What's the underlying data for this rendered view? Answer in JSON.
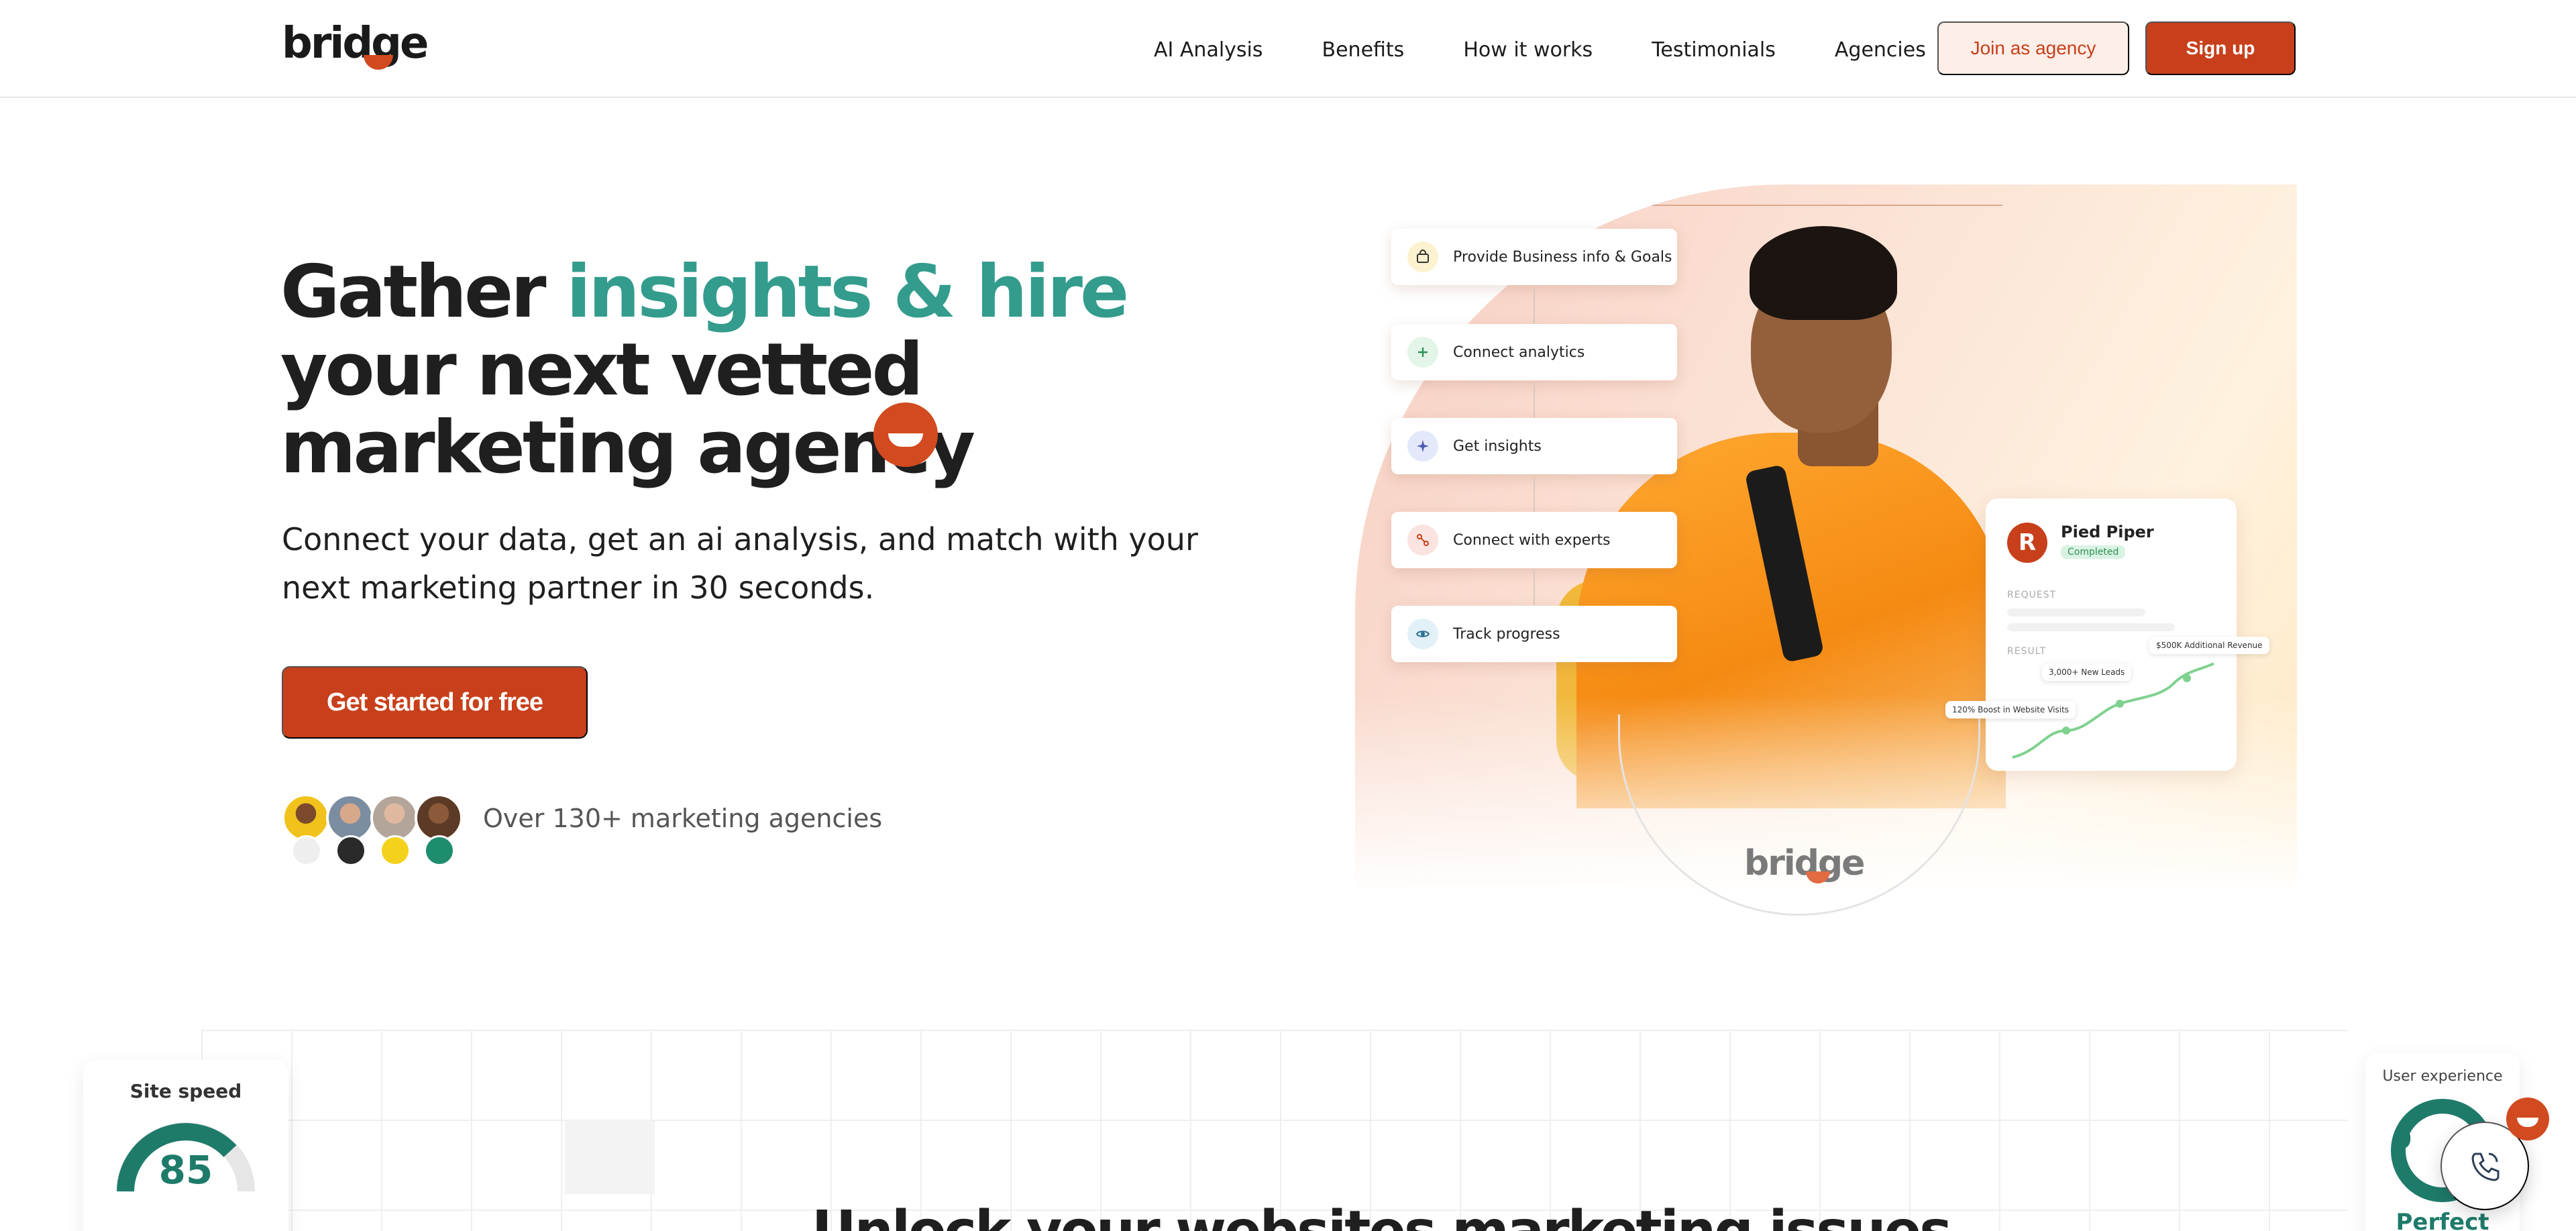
{
  "brand": {
    "logo_text": "bridge",
    "accent_color": "#c7401b",
    "teal_color": "#339c8d"
  },
  "nav": {
    "links": [
      "AI Analysis",
      "Benefits",
      "How it works",
      "Testimonials",
      "Agencies"
    ],
    "join_label": "Join as agency",
    "signup_label": "Sign up"
  },
  "hero": {
    "title_part1": "Gather ",
    "title_accent": "insights & hire",
    "title_line2": "your next vetted",
    "title_line3": "marketing agency",
    "subtitle": "Connect your data, get an ai analysis, and match with your next marketing partner in 30 seconds.",
    "cta_label": "Get started for free",
    "agencies_text": "Over 130+ marketing agencies"
  },
  "steps": [
    {
      "label": "Provide Business info & Goals",
      "icon": "bag-icon"
    },
    {
      "label": "Connect analytics",
      "icon": "plus-icon"
    },
    {
      "label": "Get insights",
      "icon": "sparkle-icon"
    },
    {
      "label": "Connect with experts",
      "icon": "connect-icon"
    },
    {
      "label": "Track progress",
      "icon": "eye-icon"
    }
  ],
  "result_card": {
    "logo_letter": "R",
    "company": "Pied Piper",
    "status": "Completed",
    "request_label": "REQUEST",
    "result_label": "RESULT",
    "tags": [
      "120% Boost in Website Visits",
      "3,000+ New Leads",
      "$500K Additional Revenue"
    ]
  },
  "circle_logo": "bridge",
  "section_title": "Unlock your websites marketing issues",
  "metrics": {
    "site_speed_label": "Site speed",
    "site_speed_value": "85",
    "ux_label": "User experience",
    "ux_value": "9",
    "ux_rating": "Perfect"
  }
}
